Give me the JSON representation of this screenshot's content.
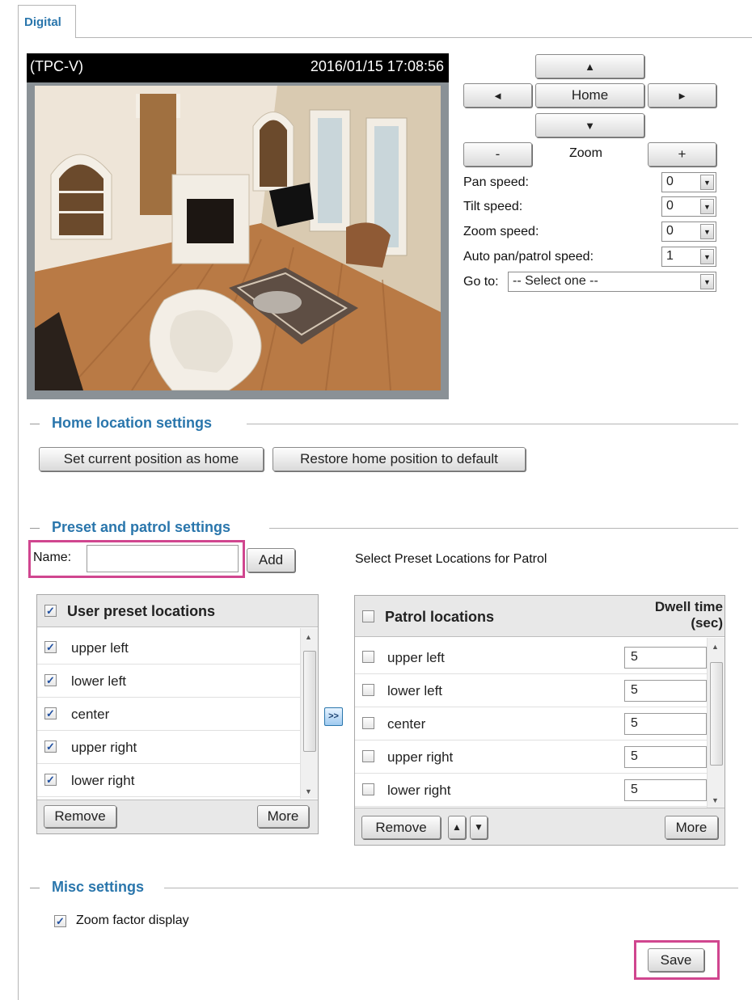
{
  "tab": {
    "label": "Digital"
  },
  "video": {
    "title": "(TPC-V)",
    "timestamp": "2016/01/15  17:08:56"
  },
  "ptz": {
    "up": "▲",
    "down": "▼",
    "left": "◄",
    "right": "►",
    "home": "Home",
    "zoom_out": "-",
    "zoom_label": "Zoom",
    "zoom_in": "+",
    "pan_speed_label": "Pan speed:",
    "pan_speed": "0",
    "tilt_speed_label": "Tilt speed:",
    "tilt_speed": "0",
    "zoom_speed_label": "Zoom speed:",
    "zoom_speed": "0",
    "auto_speed_label": "Auto pan/patrol speed:",
    "auto_speed": "1",
    "goto_label": "Go to:",
    "goto_value": "-- Select one --"
  },
  "home_section": {
    "title": "Home location settings",
    "set_home": "Set current position as home",
    "restore_home": "Restore home position to default"
  },
  "preset_section": {
    "title": "Preset and patrol settings",
    "name_label": "Name:",
    "name_value": "",
    "add": "Add",
    "select_caption": "Select Preset Locations for Patrol",
    "user_header": "User preset locations",
    "user_items": [
      "upper left",
      "lower left",
      "center",
      "upper right",
      "lower right"
    ],
    "remove": "Remove",
    "more": "More",
    "transfer": ">>",
    "patrol_header": "Patrol locations",
    "dwell_header_1": "Dwell time",
    "dwell_header_2": "(sec)",
    "patrol_items": [
      {
        "name": "upper left",
        "dwell": "5"
      },
      {
        "name": "lower left",
        "dwell": "5"
      },
      {
        "name": "center",
        "dwell": "5"
      },
      {
        "name": "upper right",
        "dwell": "5"
      },
      {
        "name": "lower right",
        "dwell": "5"
      }
    ],
    "move_up": "▲",
    "move_down": "▼"
  },
  "misc_section": {
    "title": "Misc settings",
    "zoom_factor_label": "Zoom factor display"
  },
  "save": "Save",
  "colors": {
    "accent": "#2a76ac",
    "highlight": "#d0468f"
  }
}
